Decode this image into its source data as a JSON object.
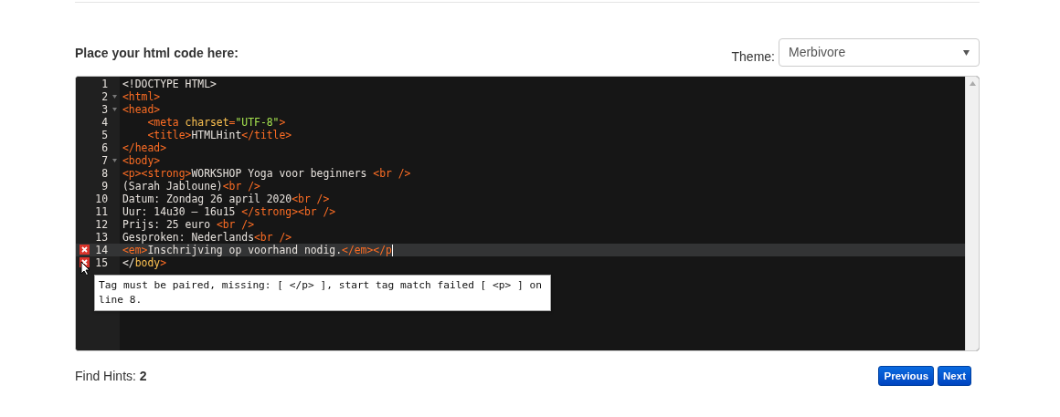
{
  "heading": "Place your html code here:",
  "theme": {
    "label": "Theme:",
    "value": "Merbivore"
  },
  "editor": {
    "lines": [
      {
        "number": "1",
        "tokens": [
          {
            "kind": "plain",
            "text": "<!DOCTYPE HTML>"
          }
        ]
      },
      {
        "number": "2",
        "fold": true,
        "tokens": [
          {
            "kind": "tag",
            "text": "<html>"
          }
        ]
      },
      {
        "number": "3",
        "fold": true,
        "tokens": [
          {
            "kind": "tag",
            "text": "<head>"
          }
        ]
      },
      {
        "number": "4",
        "tokens": [
          {
            "kind": "tag",
            "text": "    <meta "
          },
          {
            "kind": "attr",
            "text": "charset"
          },
          {
            "kind": "tag",
            "text": "="
          },
          {
            "kind": "string",
            "text": "\"UTF-8\""
          },
          {
            "kind": "tag",
            "text": ">"
          }
        ]
      },
      {
        "number": "5",
        "tokens": [
          {
            "kind": "tag",
            "text": "    <title>"
          },
          {
            "kind": "plain",
            "text": "HTMLHint"
          },
          {
            "kind": "tag",
            "text": "</title>"
          }
        ]
      },
      {
        "number": "6",
        "tokens": [
          {
            "kind": "tag",
            "text": "</head>"
          }
        ]
      },
      {
        "number": "7",
        "fold": true,
        "tokens": [
          {
            "kind": "tag",
            "text": "<body>"
          }
        ]
      },
      {
        "number": "8",
        "tokens": [
          {
            "kind": "tag",
            "text": "<p><strong>"
          },
          {
            "kind": "plain",
            "text": "WORKSHOP Yoga voor beginners "
          },
          {
            "kind": "tag",
            "text": "<br />"
          }
        ]
      },
      {
        "number": "9",
        "tokens": [
          {
            "kind": "plain",
            "text": "(Sarah Jabloune)"
          },
          {
            "kind": "tag",
            "text": "<br />"
          }
        ]
      },
      {
        "number": "10",
        "tokens": [
          {
            "kind": "plain",
            "text": "Datum: Zondag 26 april 2020"
          },
          {
            "kind": "tag",
            "text": "<br />"
          }
        ]
      },
      {
        "number": "11",
        "tokens": [
          {
            "kind": "plain",
            "text": "Uur: 14u30 – 16u15 "
          },
          {
            "kind": "tag",
            "text": "</strong><br />"
          }
        ]
      },
      {
        "number": "12",
        "tokens": [
          {
            "kind": "plain",
            "text": "Prijs: 25 euro "
          },
          {
            "kind": "tag",
            "text": "<br />"
          }
        ]
      },
      {
        "number": "13",
        "tokens": [
          {
            "kind": "plain",
            "text": "Gesproken: Nederlands"
          },
          {
            "kind": "tag",
            "text": "<br />"
          }
        ]
      },
      {
        "number": "14",
        "error": true,
        "active": true,
        "tokens": [
          {
            "kind": "tag",
            "text": "<em>"
          },
          {
            "kind": "plain",
            "text": "Inschrijving op voorhand nodig."
          },
          {
            "kind": "tag",
            "text": "</em></p"
          }
        ]
      },
      {
        "number": "15",
        "error": true,
        "tokens": [
          {
            "kind": "plain",
            "text": "</"
          },
          {
            "kind": "match",
            "text": "body"
          },
          {
            "kind": "tag",
            "text": ">"
          }
        ]
      }
    ],
    "tooltip": "Tag must be paired, missing: [ </p> ], start tag match failed [ <p> ] on line 8."
  },
  "hints": {
    "label": "Find Hints:",
    "count": "2"
  },
  "buttons": [
    {
      "label": "Previous"
    },
    {
      "label": "Next"
    }
  ]
}
